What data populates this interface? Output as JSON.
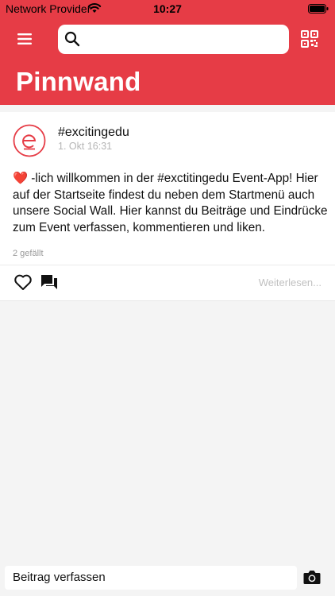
{
  "status_bar": {
    "carrier": "Network Provider",
    "time": "10:27"
  },
  "header": {
    "title": "Pinnwand",
    "search_placeholder": "",
    "accent_color": "#e63c46",
    "icons": [
      "menu-icon",
      "search-icon",
      "qr-code-icon"
    ]
  },
  "post": {
    "author": "#excitingedu",
    "date": "1. Okt 16:31",
    "heart": "❤️",
    "body": "-lich willkommen in der #exctitingedu Event-App! Hier auf der Startseite findest du neben dem Startmenü auch unsere Social Wall. Hier kannst du Beiträge und Eindrücke zum Event verfassen, kommentieren und liken.",
    "likes": "2 gefällt",
    "read_more": "Weiterlesen...",
    "icons": [
      "avatar-logo-icon",
      "heart-outline-icon",
      "comments-icon"
    ]
  },
  "composer": {
    "label": "Beitrag verfassen",
    "icon": "camera-icon"
  }
}
